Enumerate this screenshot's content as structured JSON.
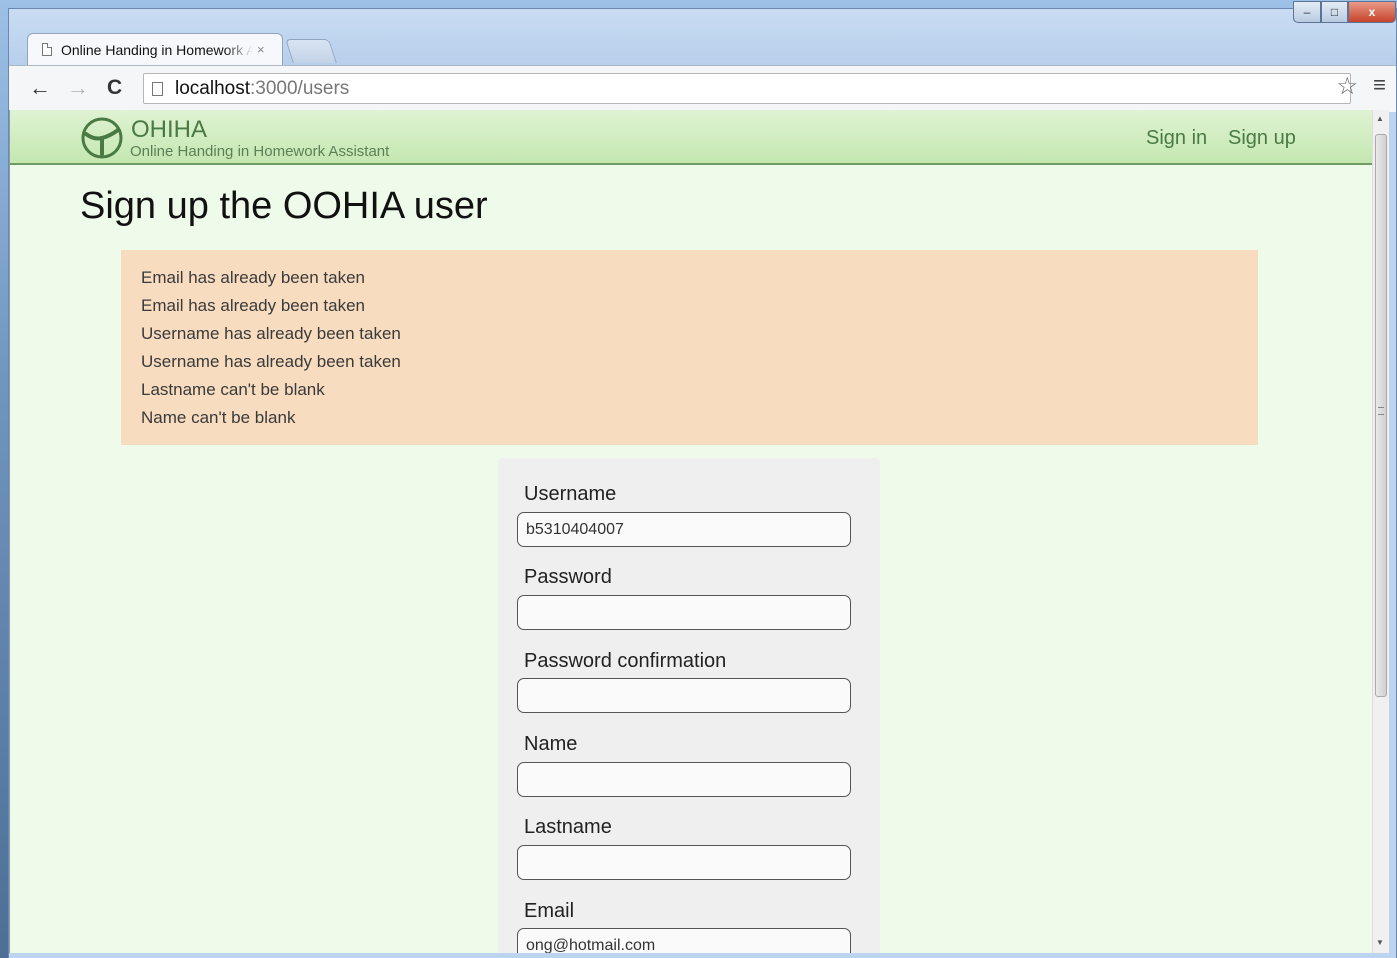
{
  "browser": {
    "tab_title": "Online Handing in Homework Assistant",
    "tab_close": "×",
    "url_host": "localhost",
    "url_path": ":3000/users",
    "back_icon": "←",
    "forward_icon": "→",
    "reload_icon": "C",
    "star_icon": "☆",
    "menu_icon": "≡",
    "min_icon": "–",
    "max_icon": "□",
    "close_icon": "x"
  },
  "site": {
    "brand_name": "OHIHA",
    "brand_sub": "Online Handing in Homework Assistant",
    "nav_signin": "Sign in",
    "nav_signup": "Sign up"
  },
  "page": {
    "title": "Sign up the OOHIA user",
    "errors": [
      "Email has already been taken",
      "Email has already been taken",
      "Username has already been taken",
      "Username has already been taken",
      "Lastname can't be blank",
      "Name can't be blank"
    ]
  },
  "form": {
    "username_label": "Username",
    "username_value": "b5310404007",
    "password_label": "Password",
    "password_value": "",
    "password_confirmation_label": "Password confirmation",
    "password_confirmation_value": "",
    "name_label": "Name",
    "name_value": "",
    "lastname_label": "Lastname",
    "lastname_value": "",
    "email_label": "Email",
    "email_value": "ong@hotmail.com"
  },
  "colors": {
    "nav_green": "#4a7a44",
    "page_bg": "#eefaea",
    "error_bg": "#f7dcbf"
  }
}
